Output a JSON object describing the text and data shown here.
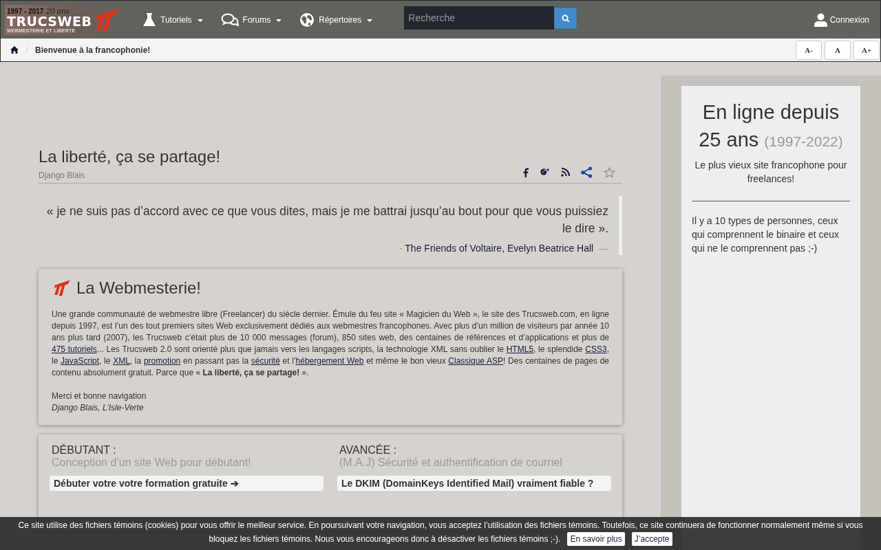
{
  "logo": {
    "years": "1997 - 2017",
    "anniversary": "20 ans",
    "name": "TRUCSWEB",
    "tagline": "WEBMESTERIE ET LIBERTE"
  },
  "nav": {
    "items": [
      {
        "label": "Tutoriels"
      },
      {
        "label": "Forums"
      },
      {
        "label": "Répertoires"
      }
    ],
    "search": {
      "placeholder": "Recherche"
    },
    "login": "Connexion"
  },
  "breadcrumb": {
    "current": "Bienvenue à la francophonie!"
  },
  "font_buttons": [
    "A-",
    "A",
    "A+"
  ],
  "article": {
    "title": "La liberté, ça se partage!",
    "author": "Django Blais",
    "quote": {
      "text": "« je ne suis pas d’accord avec ce que vous dites, mais je me battrai jusqu’au bout pour que vous puissiez le dire ».",
      "dash": "-",
      "source": "The Friends of Voltaire, Evelyn Beatrice Hall",
      "trail": "—"
    }
  },
  "webmesterie": {
    "title": "La Webmesterie!",
    "paragraph": [
      {
        "kind": "text",
        "text": "Une grande communauté de webmestre libre (Freelancer) du siècle dernier. Émule du feu site « Magicien du Web », le site des Trucsweb.com, en ligne depuis 1997, est l’un des tout premiers sites Web exclusivement dédiés aux webmestres francophones. Avec plus d’un million de visiteurs par année 10 ans plus tard (2007), les Trucsweb c’était plus de 10 000 messages (forum), 850 sites web, des centaines de références et d’applications et plus de "
      },
      {
        "kind": "link",
        "text": "475 tutoriels"
      },
      {
        "kind": "text",
        "text": "... Les Trucsweb 2.0 sont orienté plus que jamais vers les langages scripts, la technologie XML sans oublier le "
      },
      {
        "kind": "link",
        "text": "HTML5"
      },
      {
        "kind": "text",
        "text": ", le splendide "
      },
      {
        "kind": "link",
        "text": "CSS3"
      },
      {
        "kind": "text",
        "text": ", le "
      },
      {
        "kind": "link",
        "text": "JavaScript"
      },
      {
        "kind": "text",
        "text": ", le "
      },
      {
        "kind": "link",
        "text": "XML"
      },
      {
        "kind": "text",
        "text": ", la "
      },
      {
        "kind": "link",
        "text": "promotion"
      },
      {
        "kind": "text",
        "text": " en passant pas la "
      },
      {
        "kind": "link",
        "text": "sécurité"
      },
      {
        "kind": "text",
        "text": " et l’"
      },
      {
        "kind": "link",
        "text": "hébergement Web"
      },
      {
        "kind": "text",
        "text": " et même le bon vieux "
      },
      {
        "kind": "link",
        "text": "Classique ASP"
      },
      {
        "kind": "text",
        "text": "! Des centaines de pages de contenu absolument gratuit. Parce que « "
      },
      {
        "kind": "bold",
        "text": "La liberté, ça se partage!"
      },
      {
        "kind": "text",
        "text": " »."
      }
    ],
    "closing": "Merci et bonne navigation",
    "signature": "Django Blais, L’Isle-Verte"
  },
  "levels": [
    {
      "heading": "DÉBUTANT :",
      "subtitle": "Conception d’un site Web pour débutant!",
      "button": "Débuter votre votre formation gratuite ➔"
    },
    {
      "heading": "AVANCÉE :",
      "subtitle": "(M.A.J) Sécurité et authentification de courriel",
      "button": "Le DKIM (DomainKeys Identified Mail) vraiment fiable ?"
    }
  ],
  "sidebar": {
    "title": "En ligne depuis 25 ans",
    "years": "(1997-2022)",
    "subtitle": "Le plus vieux site francophone pour freelances!",
    "joke": "Il y a 10 types de personnes, ceux qui comprennent le binaire et ceux qui ne le comprennent pas ;-)"
  },
  "cookie": {
    "lines": [
      "Ce site utilise des fichiers témoins (cookies) pour vous offrir le meilleur service. En poursuivant votre navigation, vous acceptez l’utilisation des fichiers témoins. Toutefois, ce site continuera de fonctionner normalement même si vous",
      "bloquez les fichiers témoins. Nous vous encourageons donc à désactiver les fichiers témoins ;-)."
    ],
    "buttons": [
      "En savoir plus",
      "J’accepte"
    ]
  }
}
